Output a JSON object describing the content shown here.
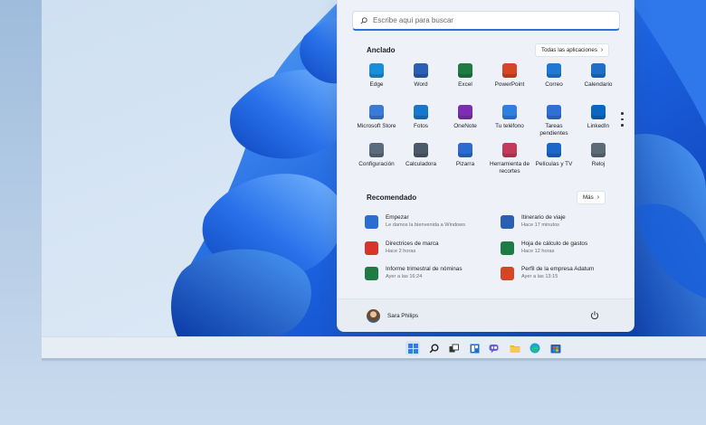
{
  "search": {
    "placeholder": "Escribe aquí para buscar"
  },
  "pinned": {
    "title": "Anclado",
    "all_apps_label": "Todas las aplicaciones",
    "apps": [
      {
        "label": "Edge",
        "icon": "edge-icon",
        "color": "#1a8fd8"
      },
      {
        "label": "Word",
        "icon": "word-icon",
        "color": "#2b5fb4"
      },
      {
        "label": "Excel",
        "icon": "excel-icon",
        "color": "#1f7a44"
      },
      {
        "label": "PowerPoint",
        "icon": "powerpoint-icon",
        "color": "#d24726"
      },
      {
        "label": "Correo",
        "icon": "mail-icon",
        "color": "#1f78d1"
      },
      {
        "label": "Calendario",
        "icon": "calendar-icon",
        "color": "#1e6fc7"
      },
      {
        "label": "Microsoft Store",
        "icon": "store-icon",
        "color": "#3a7bd5"
      },
      {
        "label": "Fotos",
        "icon": "photos-icon",
        "color": "#1877c9"
      },
      {
        "label": "OneNote",
        "icon": "onenote-icon",
        "color": "#7b2fb0"
      },
      {
        "label": "Tu teléfono",
        "icon": "phone-icon",
        "color": "#2d7fe0"
      },
      {
        "label": "Tareas pendientes",
        "icon": "todo-icon",
        "color": "#2f6fd6"
      },
      {
        "label": "LinkedIn",
        "icon": "linkedin-icon",
        "color": "#0a66c2"
      },
      {
        "label": "Configuración",
        "icon": "settings-icon",
        "color": "#5a6b7d"
      },
      {
        "label": "Calculadora",
        "icon": "calculator-icon",
        "color": "#4b5a6a"
      },
      {
        "label": "Pizarra",
        "icon": "whiteboard-icon",
        "color": "#2c6ad0"
      },
      {
        "label": "Herramienta de recortes",
        "icon": "snipping-icon",
        "color": "#c33b5a"
      },
      {
        "label": "Películas y TV",
        "icon": "movies-icon",
        "color": "#1b66c9"
      },
      {
        "label": "Reloj",
        "icon": "clock-icon",
        "color": "#5d6a77"
      }
    ]
  },
  "recommended": {
    "title": "Recomendado",
    "more_label": "Más",
    "items": [
      {
        "title": "Empezar",
        "subtitle": "Le damos la bienvenida a Windows",
        "icon": "get-started-icon",
        "color": "#2a6fd0"
      },
      {
        "title": "Itinerario de viaje",
        "subtitle": "Hace 17 minutos",
        "icon": "word-doc-icon",
        "color": "#2b5fb4"
      },
      {
        "title": "Directrices de marca",
        "subtitle": "Hace 2 horas",
        "icon": "pdf-icon",
        "color": "#d9342b"
      },
      {
        "title": "Hoja de cálculo de gastos",
        "subtitle": "Hace 12 horas",
        "icon": "excel-doc-icon",
        "color": "#1f7a44"
      },
      {
        "title": "Informe trimestral de nóminas",
        "subtitle": "Ayer a las 16:24",
        "icon": "excel-doc-icon",
        "color": "#1f7a44"
      },
      {
        "title": "Perfil de la empresa Adatum",
        "subtitle": "Ayer a las 13:15",
        "icon": "powerpoint-doc-icon",
        "color": "#d24726"
      }
    ]
  },
  "user": {
    "name": "Sara Philips"
  },
  "taskbar": {
    "icons": [
      "windows-start-icon",
      "search-icon",
      "task-view-icon",
      "widgets-icon",
      "chat-icon",
      "file-explorer-icon",
      "edge-icon",
      "store-icon"
    ]
  },
  "colors": {
    "accent": "#2f6fd6",
    "bloom_dark": "#0b3fb8",
    "bloom_light": "#3f8ff2"
  }
}
